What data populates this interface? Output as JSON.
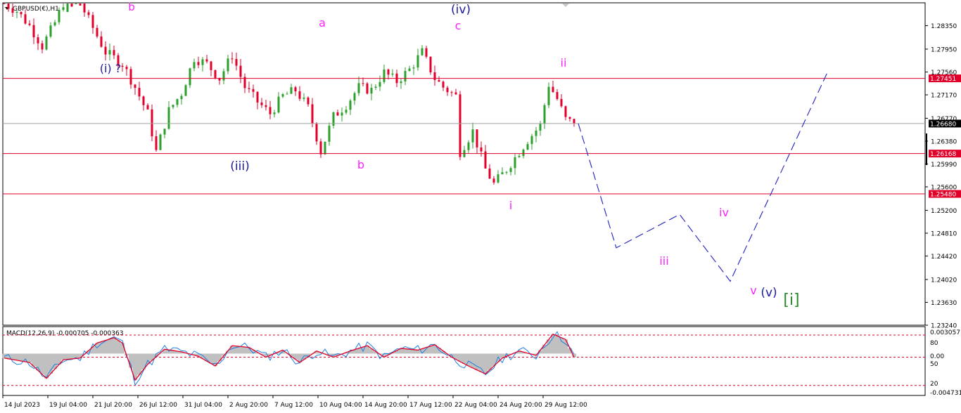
{
  "title": "GBPUSD(€),H1",
  "indicator_label": "MACD(12,26,9) -0.000705 -0.000363",
  "colors": {
    "bull": "#2ca02c",
    "bear": "#e0002a",
    "hline": "#e0002a",
    "current_line": "#a0a0a0",
    "projection": "#1f1fbf",
    "magenta": "#ff22ff",
    "navy": "#1a1aa0",
    "green": "#2a8a2a",
    "macd_hist": "#c0c0c0",
    "macd_main": "#1e7fe0",
    "macd_signal": "#e0002a"
  },
  "price_axis_ticks": [
    "1.28350",
    "1.27950",
    "1.27560",
    "1.27170",
    "1.26770",
    "1.26380",
    "1.25990",
    "1.25600",
    "1.25200",
    "1.24810",
    "1.24420",
    "1.24020",
    "1.23630",
    "1.23240"
  ],
  "time_axis_ticks": [
    "14 Jul 2023",
    "19 Jul 04:00",
    "21 Jul 20:00",
    "26 Jul 12:00",
    "31 Jul 04:00",
    "2 Aug 20:00",
    "7 Aug 12:00",
    "10 Aug 04:00",
    "14 Aug 20:00",
    "17 Aug 12:00",
    "22 Aug 04:00",
    "24 Aug 20:00",
    "29 Aug 12:00"
  ],
  "macd_axis_ticks": [
    "0.003057",
    "80",
    "0.00",
    "50",
    "20",
    "-0.004731"
  ],
  "horizontal_lines": [
    {
      "price": 1.27451,
      "label": "1.27451",
      "kind": "level"
    },
    {
      "price": 1.26168,
      "label": "1.26168",
      "kind": "level"
    },
    {
      "price": 1.2548,
      "label": "1.25480",
      "kind": "level"
    },
    {
      "price": 1.2668,
      "label": "1.26680",
      "kind": "current"
    }
  ],
  "wave_labels": [
    {
      "text": "b",
      "color": "magenta"
    },
    {
      "text": "(i) ?",
      "color": "navy"
    },
    {
      "text": "(iii)",
      "color": "navy"
    },
    {
      "text": "a",
      "color": "magenta"
    },
    {
      "text": "b",
      "color": "magenta"
    },
    {
      "text": "(iv)",
      "color": "navy"
    },
    {
      "text": "c",
      "color": "magenta"
    },
    {
      "text": "i",
      "color": "magenta"
    },
    {
      "text": "ii",
      "color": "magenta"
    },
    {
      "text": "iii",
      "color": "magenta"
    },
    {
      "text": "iv",
      "color": "magenta"
    },
    {
      "text": "v",
      "color": "magenta"
    },
    {
      "text": "(v)",
      "color": "navy"
    },
    {
      "text": "[i]",
      "color": "green"
    }
  ],
  "chart_data": {
    "type": "candlestick",
    "title": "GBPUSD(€),H1",
    "ylim": [
      1.2324,
      1.2874
    ],
    "price_path": [
      [
        0,
        1.2874
      ],
      [
        3,
        1.286
      ],
      [
        6,
        1.2835
      ],
      [
        9,
        1.28
      ],
      [
        12,
        1.284
      ],
      [
        14,
        1.2874
      ],
      [
        18,
        1.2874
      ],
      [
        20,
        1.2845
      ],
      [
        24,
        1.279
      ],
      [
        28,
        1.277
      ],
      [
        31,
        1.273
      ],
      [
        34,
        1.2685
      ],
      [
        36,
        1.262
      ],
      [
        39,
        1.269
      ],
      [
        42,
        1.272
      ],
      [
        45,
        1.278
      ],
      [
        48,
        1.277
      ],
      [
        51,
        1.2745
      ],
      [
        54,
        1.2785
      ],
      [
        57,
        1.273
      ],
      [
        60,
        1.2705
      ],
      [
        63,
        1.2685
      ],
      [
        66,
        1.2715
      ],
      [
        69,
        1.2725
      ],
      [
        72,
        1.2695
      ],
      [
        75,
        1.262
      ],
      [
        78,
        1.268
      ],
      [
        81,
        1.27
      ],
      [
        84,
        1.273
      ],
      [
        87,
        1.2725
      ],
      [
        90,
        1.2755
      ],
      [
        93,
        1.274
      ],
      [
        96,
        1.276
      ],
      [
        99,
        1.279
      ],
      [
        102,
        1.2745
      ],
      [
        104,
        1.273
      ],
      [
        107,
        1.2715
      ],
      [
        108,
        1.262
      ],
      [
        111,
        1.2655
      ],
      [
        114,
        1.259
      ],
      [
        116,
        1.2565
      ],
      [
        119,
        1.259
      ],
      [
        121,
        1.261
      ],
      [
        124,
        1.264
      ],
      [
        127,
        1.2665
      ],
      [
        129,
        1.2735
      ],
      [
        131,
        1.271
      ],
      [
        133,
        1.2675
      ],
      [
        135,
        1.2668
      ]
    ],
    "projection_path": [
      [
        136,
        1.2668
      ],
      [
        145,
        1.2456
      ],
      [
        160,
        1.2513
      ],
      [
        172,
        1.2399
      ],
      [
        195,
        1.2755
      ]
    ],
    "macd": {
      "ylim": [
        -0.004731,
        0.003057
      ],
      "signal_path": [
        [
          0,
          -0.0005
        ],
        [
          6,
          -0.001
        ],
        [
          10,
          -0.0028
        ],
        [
          14,
          -0.0007
        ],
        [
          18,
          -0.0005
        ],
        [
          22,
          0.0012
        ],
        [
          26,
          0.0018
        ],
        [
          28,
          0.0012
        ],
        [
          31,
          -0.003
        ],
        [
          34,
          -0.0012
        ],
        [
          38,
          0.0005
        ],
        [
          42,
          0.0002
        ],
        [
          46,
          -0.0003
        ],
        [
          50,
          -0.0014
        ],
        [
          54,
          0.0009
        ],
        [
          58,
          0.0007
        ],
        [
          62,
          -0.0004
        ],
        [
          66,
          0.0004
        ],
        [
          70,
          -0.001
        ],
        [
          74,
          0.0003
        ],
        [
          78,
          -0.0004
        ],
        [
          82,
          0.0003
        ],
        [
          86,
          0.0009
        ],
        [
          90,
          -0.0004
        ],
        [
          94,
          0.0006
        ],
        [
          98,
          0.0004
        ],
        [
          102,
          0.001
        ],
        [
          106,
          -0.0004
        ],
        [
          110,
          -0.0014
        ],
        [
          114,
          -0.0023
        ],
        [
          118,
          -0.0005
        ],
        [
          122,
          0.0003
        ],
        [
          126,
          -0.0002
        ],
        [
          130,
          0.0022
        ],
        [
          133,
          0.0016
        ],
        [
          135,
          -0.0004
        ]
      ]
    }
  }
}
